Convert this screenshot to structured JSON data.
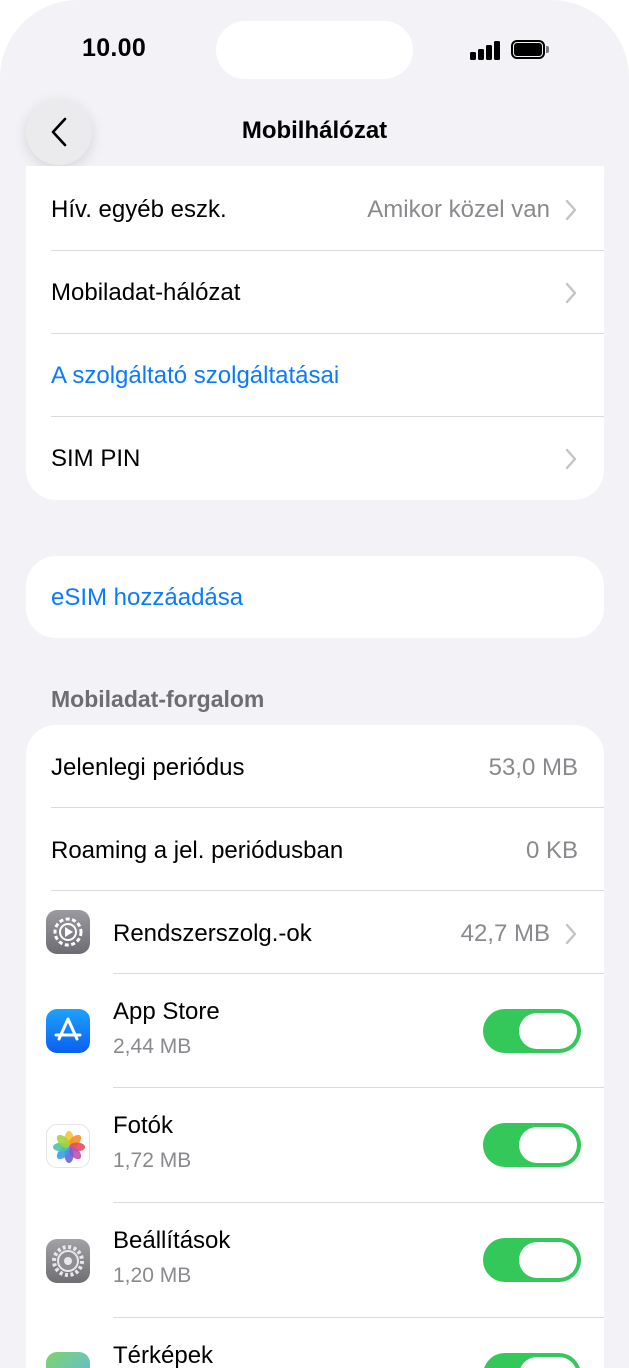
{
  "status_bar": {
    "time": "10.00"
  },
  "nav": {
    "title": "Mobilhálózat"
  },
  "group1": {
    "rows": [
      {
        "label": "Hív. egyéb eszk.",
        "value": "Amikor közel van"
      },
      {
        "label": "Mobiladat-hálózat"
      },
      {
        "label": "A szolgáltató szolgáltatásai"
      },
      {
        "label": "SIM PIN"
      }
    ]
  },
  "group2": {
    "label": "eSIM hozzáadása"
  },
  "usage": {
    "header": "Mobiladat-forgalom",
    "current_period": {
      "label": "Jelenlegi periódus",
      "value": "53,0 MB"
    },
    "roaming": {
      "label": "Roaming a jel. periódusban",
      "value": "0 KB"
    },
    "system_services": {
      "label": "Rendszerszolg.-ok",
      "value": "42,7 MB"
    },
    "apps": [
      {
        "name": "App Store",
        "size": "2,44 MB",
        "enabled": true,
        "icon": "app-store-icon"
      },
      {
        "name": "Fotók",
        "size": "1,72 MB",
        "enabled": true,
        "icon": "photos-icon"
      },
      {
        "name": "Beállítások",
        "size": "1,20 MB",
        "enabled": true,
        "icon": "settings-icon"
      },
      {
        "name": "Térképek",
        "enabled": true,
        "icon": "maps-icon"
      }
    ]
  },
  "colors": {
    "accent": "#0a7aff",
    "toggle_on": "#34c759",
    "background": "#f2f2f7"
  }
}
